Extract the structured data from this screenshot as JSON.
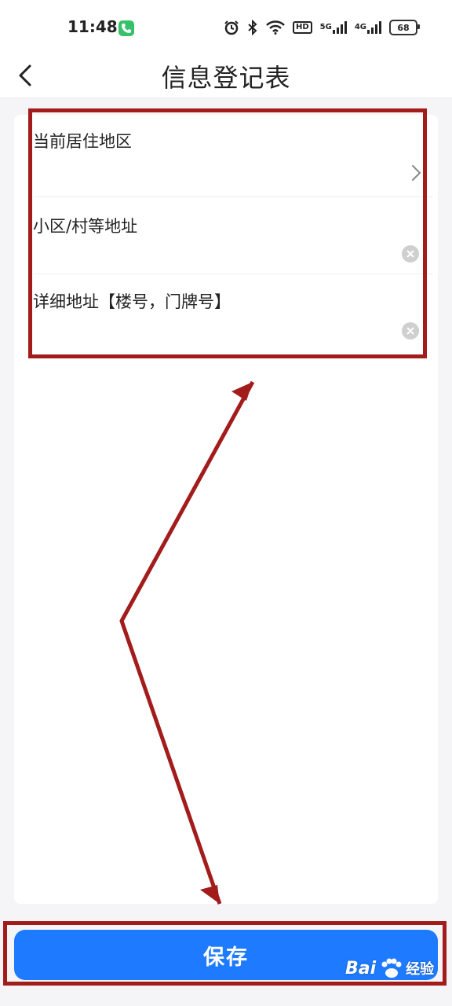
{
  "status_bar": {
    "time": "11:48",
    "hd_label": "HD",
    "net_5g": "5G",
    "net_4g": "4G",
    "battery_level": "68"
  },
  "header": {
    "title": "信息登记表"
  },
  "form": {
    "fields": [
      {
        "label": "当前居住地区",
        "value": "",
        "control": "chevron-right"
      },
      {
        "label": "小区/村等地址",
        "value": "",
        "control": "clear"
      },
      {
        "label": "详细地址【楼号，门牌号】",
        "value": "",
        "control": "clear"
      }
    ]
  },
  "footer": {
    "save_label": "保存"
  },
  "watermark": {
    "brand_text": "Bai",
    "brand_suffix": "经验"
  },
  "colors": {
    "primary": "#1e7bff",
    "annotation": "#a31c1c",
    "background": "#f5f5f7"
  }
}
